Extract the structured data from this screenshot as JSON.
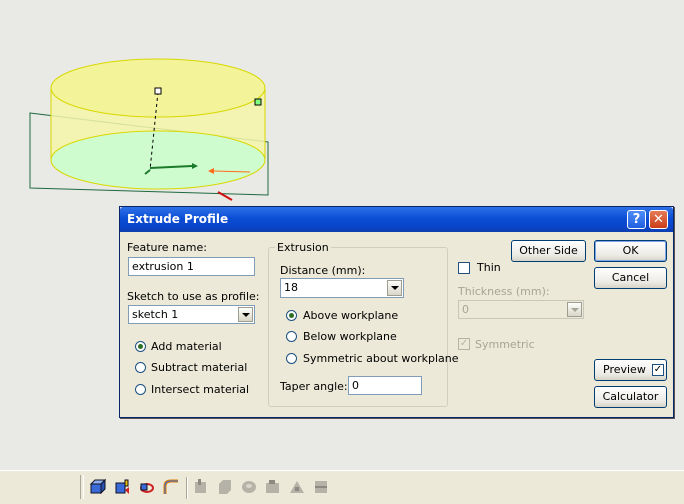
{
  "dialog": {
    "title": "Extrude Profile",
    "help_label": "?",
    "close_label": "✕",
    "feature_name_label": "Feature name:",
    "feature_name_value": "extrusion 1",
    "sketch_label": "Sketch to use as profile:",
    "sketch_value": "sketch 1",
    "material_options": [
      "Add material",
      "Subtract material",
      "Intersect material"
    ],
    "material_selected": "Add material",
    "extrusion_group_title": "Extrusion",
    "distance_label": "Distance (mm):",
    "distance_value": "18",
    "workplane_options": [
      "Above workplane",
      "Below workplane",
      "Symmetric about workplane"
    ],
    "workplane_selected": "Above workplane",
    "taper_label": "Taper angle:",
    "taper_value": "0",
    "other_side_label": "Other Side",
    "thin_label": "Thin",
    "thin_checked": false,
    "thickness_label": "Thickness (mm):",
    "thickness_value": "0",
    "symmetric_label": "Symmetric",
    "symmetric_checked": true,
    "ok_label": "OK",
    "cancel_label": "Cancel",
    "preview_label": "Preview",
    "preview_checked": true,
    "calculator_label": "Calculator"
  },
  "toolbar": {
    "icons": [
      "extrude-icon",
      "revolve-icon",
      "sweep-icon",
      "loft-icon",
      "fillet-icon",
      "chamfer-icon",
      "shell-icon",
      "hole-icon",
      "pattern-icon",
      "mirror-icon"
    ]
  },
  "colors": {
    "viewport_bg": "#e9e9e6",
    "cylinder_fill": "#f3f39a",
    "cylinder_edge": "#d8d800",
    "base_fill": "#c8fbc8",
    "sketch_plane": "#1f6a3f",
    "title_bar": "#0b4ed6"
  }
}
